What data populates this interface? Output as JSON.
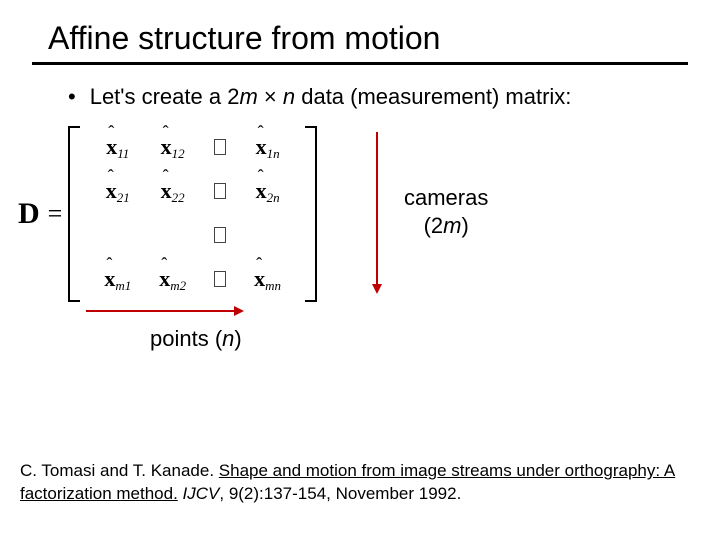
{
  "title": "Affine structure from motion",
  "bullet": {
    "lead": "Let's create a ",
    "dim1_coef": "2",
    "dim1_var": "m",
    "times": " × ",
    "dim2_var": "n",
    "tail": " data (measurement) matrix:"
  },
  "matrix": {
    "lhs": "D",
    "eq": "=",
    "cells": {
      "r1c1_sub": "11",
      "r1c2_sub": "12",
      "r1c4_sub": "1n",
      "r2c1_sub": "21",
      "r2c2_sub": "22",
      "r2c4_sub": "2n",
      "r4c1_sub": "m1",
      "r4c2_sub": "m2",
      "r4c4_sub": "mn"
    }
  },
  "labels": {
    "cameras_line1": "cameras",
    "cameras_line2_open": "(2",
    "cameras_line2_var": "m",
    "cameras_line2_close": ")",
    "points_lead": "points (",
    "points_var": "n",
    "points_close": ")"
  },
  "citation": {
    "authors": "C. Tomasi and T. Kanade. ",
    "title_link": "Shape and motion from image streams under orthography: A factorization method.",
    "venue": " IJCV",
    "rest": ", 9(2):137-154, November 1992."
  }
}
